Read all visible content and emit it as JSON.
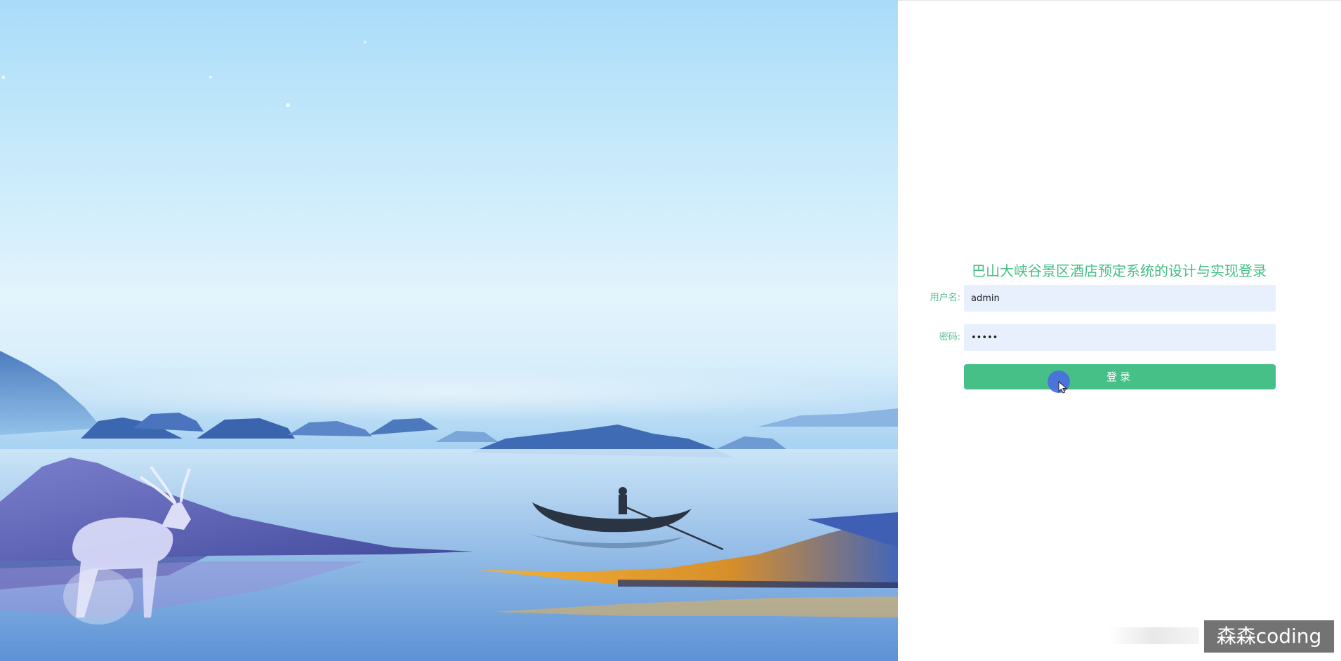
{
  "login": {
    "title": "巴山大峡谷景区酒店预定系统的设计与实现登录",
    "username_label": "用户名:",
    "username_value": "admin",
    "password_label": "密码:",
    "password_value": "•••••",
    "button_label": "登录"
  },
  "watermark": {
    "text": "森森coding"
  },
  "colors": {
    "accent": "#47c088",
    "title": "#44bf85",
    "input_bg": "#e8f0fe"
  },
  "icons": {
    "cursor": "pointer-arrow-icon"
  }
}
